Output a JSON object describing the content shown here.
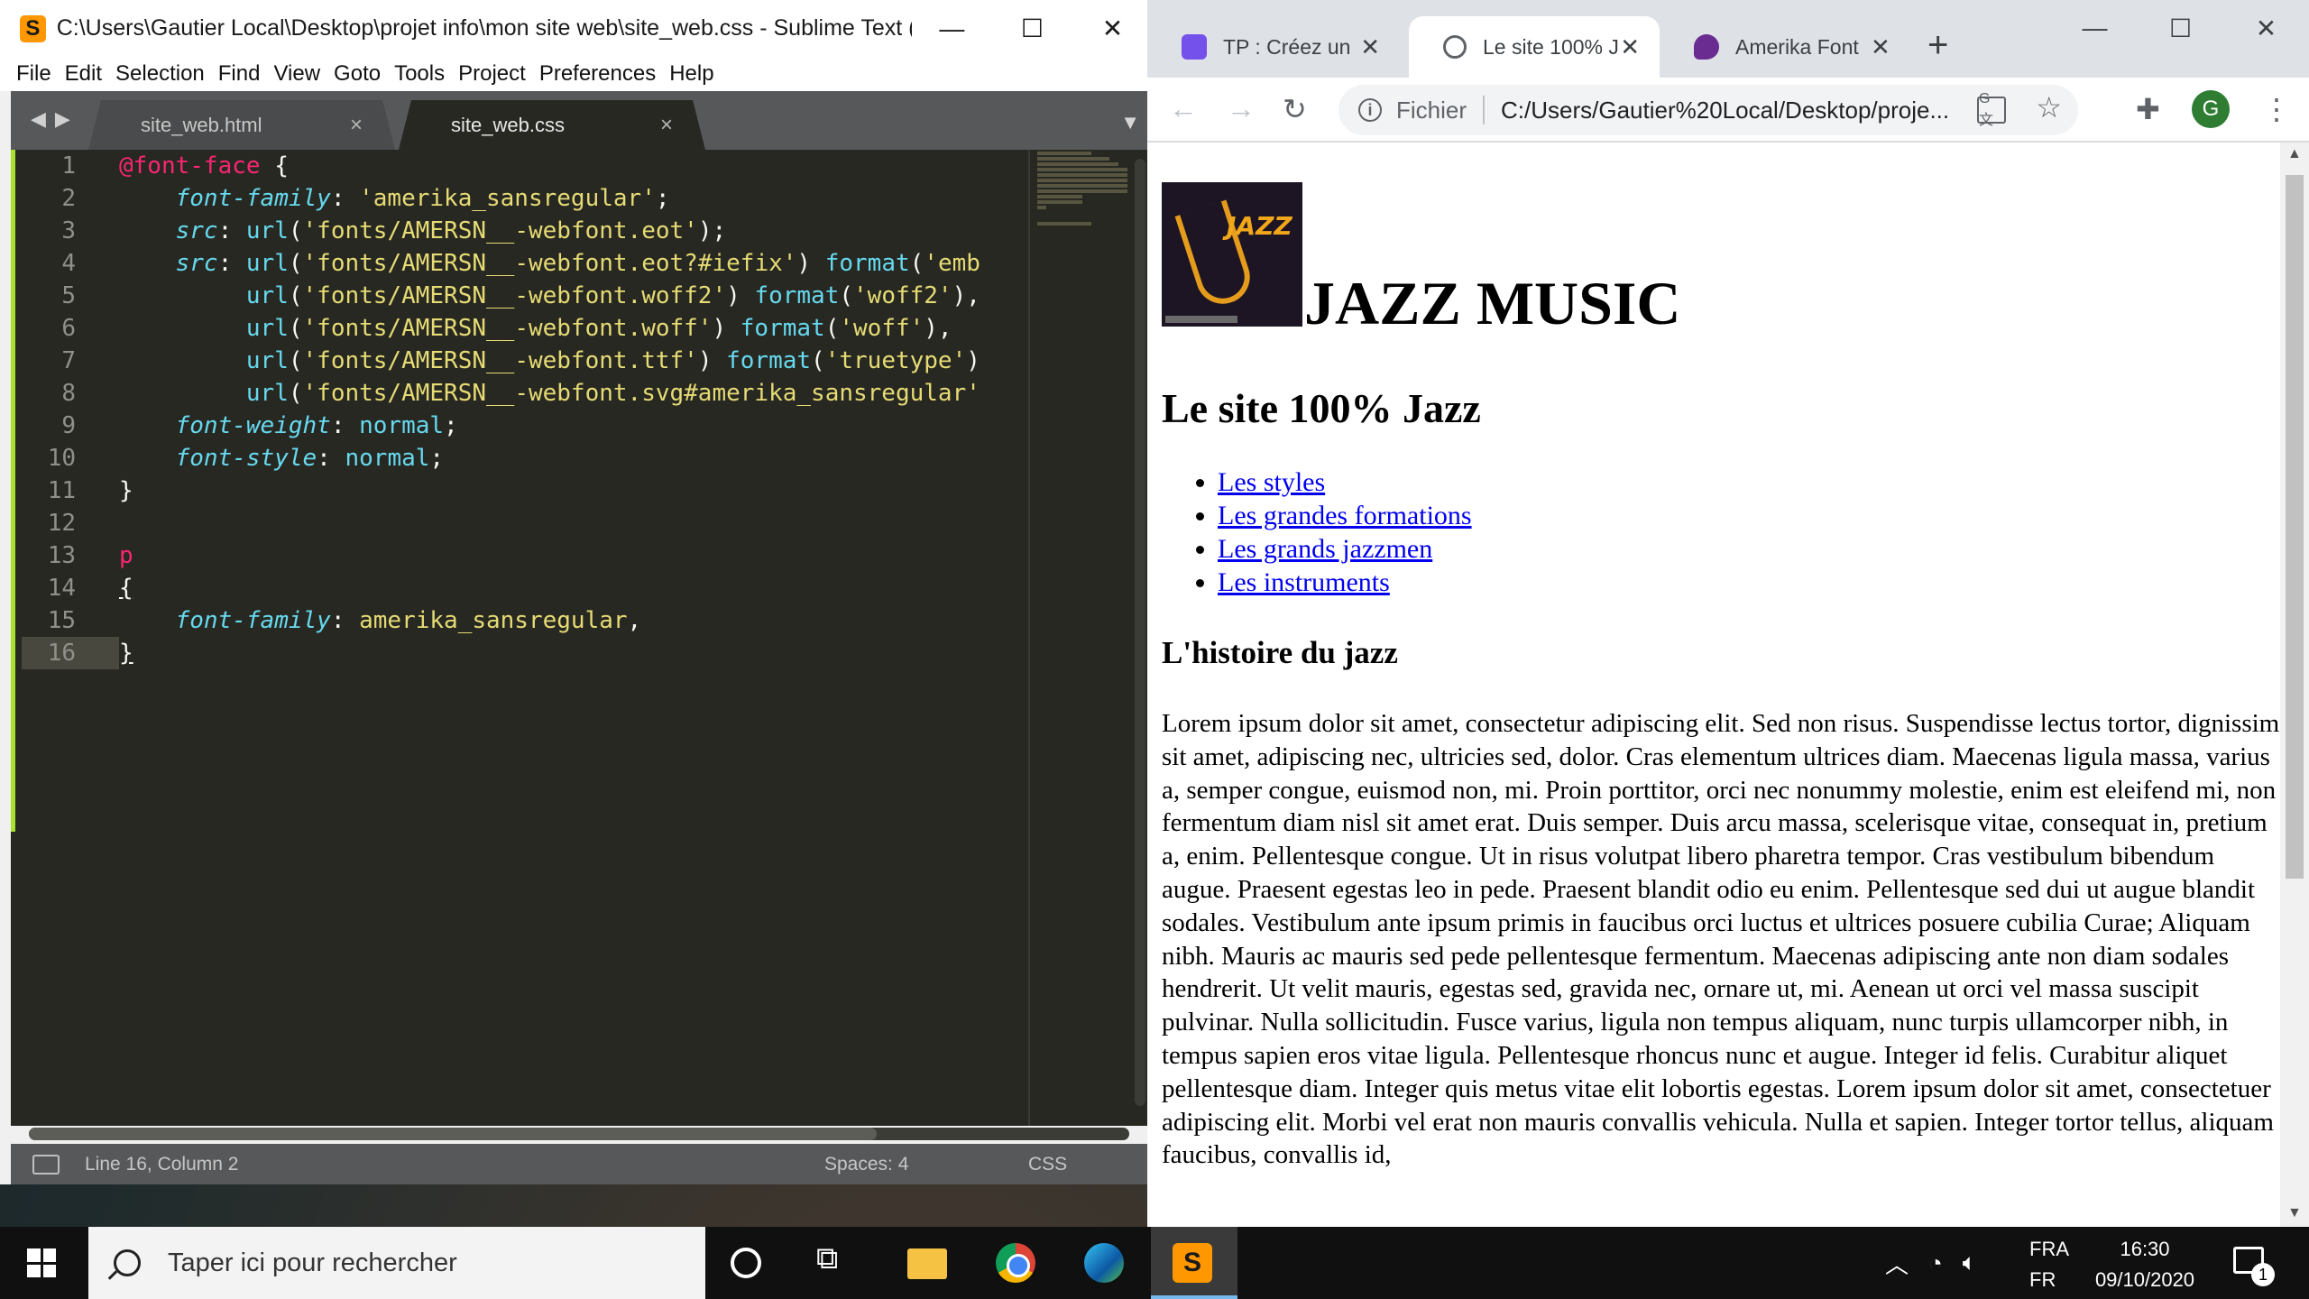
{
  "sublime": {
    "title": "C:\\Users\\Gautier Local\\Desktop\\projet info\\mon site web\\site_web.css - Sublime Text (...",
    "menu": [
      "File",
      "Edit",
      "Selection",
      "Find",
      "View",
      "Goto",
      "Tools",
      "Project",
      "Preferences",
      "Help"
    ],
    "tabs": [
      "site_web.html",
      "site_web.css"
    ],
    "line_numbers": [
      "1",
      "2",
      "3",
      "4",
      "5",
      "6",
      "7",
      "8",
      "9",
      "10",
      "11",
      "12",
      "13",
      "14",
      "15",
      "16"
    ],
    "code": {
      "l1_at": "@font-face",
      "l1_brace": " {",
      "l2_prop": "font-family",
      "l2_val": "'amerika_sansregular'",
      "l3_prop": "src",
      "l3_fn": "url",
      "l3_str": "'fonts/AMERSN__-webfont.eot'",
      "l4_prop": "src",
      "l4_fn": "url",
      "l4_str": "'fonts/AMERSN__-webfont.eot?#iefix'",
      "l4_fn2": "format",
      "l4_str2": "'emb",
      "l5_fn": "url",
      "l5_str": "'fonts/AMERSN__-webfont.woff2'",
      "l5_fn2": "format",
      "l5_str2": "'woff2'",
      "l6_fn": "url",
      "l6_str": "'fonts/AMERSN__-webfont.woff'",
      "l6_fn2": "format",
      "l6_str2": "'woff'",
      "l7_fn": "url",
      "l7_str": "'fonts/AMERSN__-webfont.ttf'",
      "l7_fn2": "format",
      "l7_str2": "'truetype'",
      "l8_fn": "url",
      "l8_str": "'fonts/AMERSN__-webfont.svg#amerika_sansregular'",
      "l9_prop": "font-weight",
      "l9_val": "normal",
      "l10_prop": "font-style",
      "l10_val": "normal",
      "l11": "}",
      "l13": "p",
      "l14": "{",
      "l15_prop": "font-family",
      "l15_val": "amerika_sansregular",
      "l16": "}"
    },
    "status": {
      "position": "Line 16, Column 2",
      "spaces": "Spaces: 4",
      "syntax": "CSS"
    }
  },
  "chrome": {
    "tabs": [
      {
        "title": "TP : Créez un",
        "favicon": "openclassrooms-icon",
        "color": "#7451eb"
      },
      {
        "title": "Le site 100% J",
        "favicon": "globe-icon",
        "color": "#5f6368"
      },
      {
        "title": "Amerika Font",
        "favicon": "fontsquirrel-icon",
        "color": "#6a2c91"
      }
    ],
    "omnibox": {
      "scheme_label": "Fichier",
      "url": "C:/Users/Gautier%20Local/Desktop/proje..."
    },
    "avatar_letter": "G",
    "page": {
      "h1": "JAZZ MUSIC",
      "logo_text": "JAZZ",
      "h2": "Le site 100% Jazz",
      "nav": [
        "Les styles",
        "Les grandes formations",
        "Les grands jazzmen",
        "Les instruments"
      ],
      "h3": "L'histoire du jazz",
      "paragraph": "Lorem ipsum dolor sit amet, consectetur adipiscing elit. Sed non risus. Suspendisse lectus tortor, dignissim sit amet, adipiscing nec, ultricies sed, dolor. Cras elementum ultrices diam. Maecenas ligula massa, varius a, semper congue, euismod non, mi. Proin porttitor, orci nec nonummy molestie, enim est eleifend mi, non fermentum diam nisl sit amet erat. Duis semper. Duis arcu massa, scelerisque vitae, consequat in, pretium a, enim. Pellentesque congue. Ut in risus volutpat libero pharetra tempor. Cras vestibulum bibendum augue. Praesent egestas leo in pede. Praesent blandit odio eu enim. Pellentesque sed dui ut augue blandit sodales. Vestibulum ante ipsum primis in faucibus orci luctus et ultrices posuere cubilia Curae; Aliquam nibh. Mauris ac mauris sed pede pellentesque fermentum. Maecenas adipiscing ante non diam sodales hendrerit. Ut velit mauris, egestas sed, gravida nec, ornare ut, mi. Aenean ut orci vel massa suscipit pulvinar. Nulla sollicitudin. Fusce varius, ligula non tempus aliquam, nunc turpis ullamcorper nibh, in tempus sapien eros vitae ligula. Pellentesque rhoncus nunc et augue. Integer id felis. Curabitur aliquet pellentesque diam. Integer quis metus vitae elit lobortis egestas. Lorem ipsum dolor sit amet, consectetuer adipiscing elit. Morbi vel erat non mauris convallis vehicula. Nulla et sapien. Integer tortor tellus, aliquam faucibus, convallis id,"
    }
  },
  "taskbar": {
    "search_placeholder": "Taper ici pour rechercher",
    "lang_top": "FRA",
    "lang_bottom": "FR",
    "time": "16:30",
    "date": "09/10/2020",
    "notif_count": "1"
  }
}
